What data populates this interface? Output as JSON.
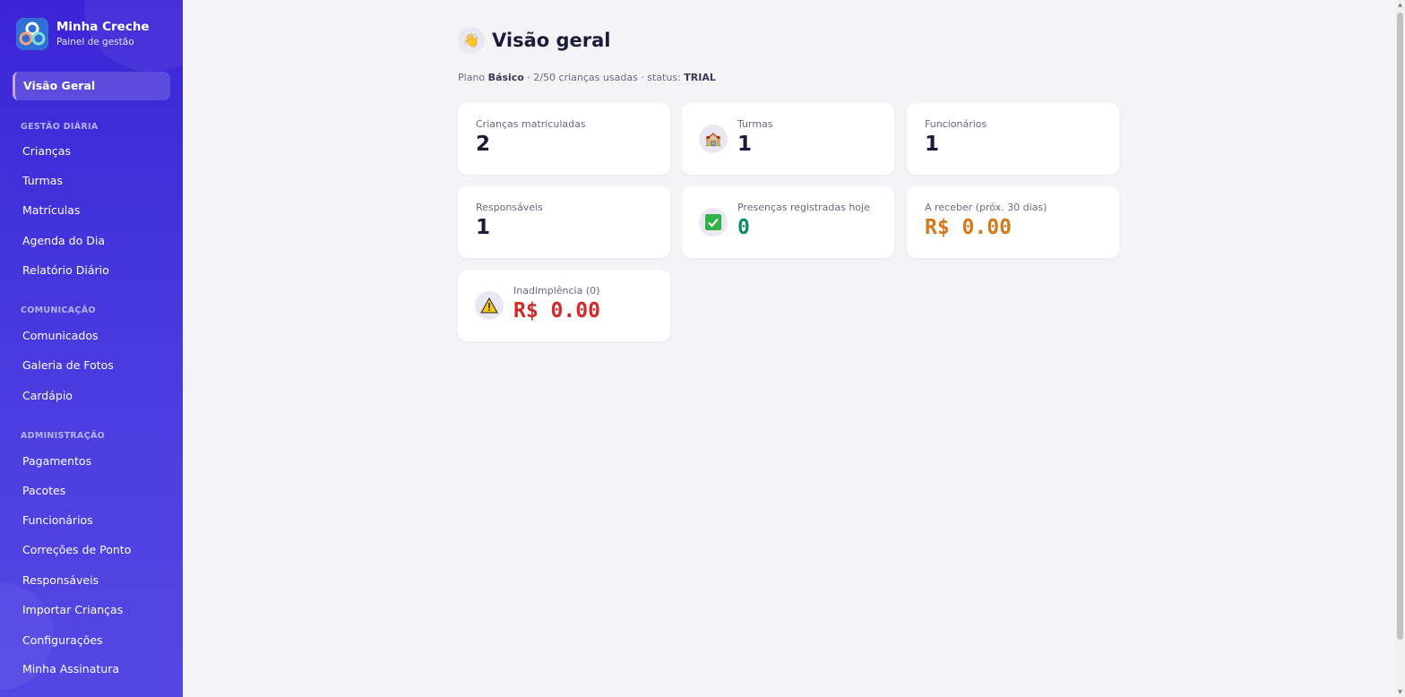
{
  "brand": {
    "title": "Minha Creche",
    "subtitle": "Painel de gestão"
  },
  "sidebar": {
    "active": "Visão Geral",
    "sections": [
      {
        "title": "GESTÃO DIÁRIA",
        "items": [
          "Crianças",
          "Turmas",
          "Matrículas",
          "Agenda do Dia",
          "Relatório Diário"
        ]
      },
      {
        "title": "COMUNICAÇÃO",
        "items": [
          "Comunicados",
          "Galeria de Fotos",
          "Cardápio"
        ]
      },
      {
        "title": "ADMINISTRAÇÃO",
        "items": [
          "Pagamentos",
          "Pacotes",
          "Funcionários",
          "Correções de Ponto",
          "Responsáveis",
          "Importar Crianças",
          "Configurações",
          "Minha Assinatura"
        ]
      }
    ]
  },
  "page": {
    "title": "Visão geral",
    "title_icon": "waving-hand-icon",
    "plan": {
      "prefix": "Plano",
      "name": "Básico",
      "usage": "· 2/50 crianças usadas · status:",
      "status": "TRIAL"
    }
  },
  "cards": [
    {
      "label": "Crianças matriculadas",
      "value": "2",
      "icon": null,
      "color": "#1d1b3a"
    },
    {
      "label": "Turmas",
      "value": "1",
      "icon": "school-icon",
      "color": "#1d1b3a"
    },
    {
      "label": "Funcionários",
      "value": "1",
      "icon": null,
      "color": "#1d1b3a"
    },
    {
      "label": "Responsáveis",
      "value": "1",
      "icon": null,
      "color": "#1d1b3a"
    },
    {
      "label": "Presenças registradas hoje",
      "value": "0",
      "icon": "check-icon",
      "color": "#0f8a6c"
    },
    {
      "label": "A receber (próx. 30 dias)",
      "value": "R$ 0.00",
      "icon": null,
      "color": "#d4791a"
    },
    {
      "label": "Inadimplência (0)",
      "value": "R$ 0.00",
      "icon": "warning-icon",
      "color": "#d12a2a"
    }
  ]
}
